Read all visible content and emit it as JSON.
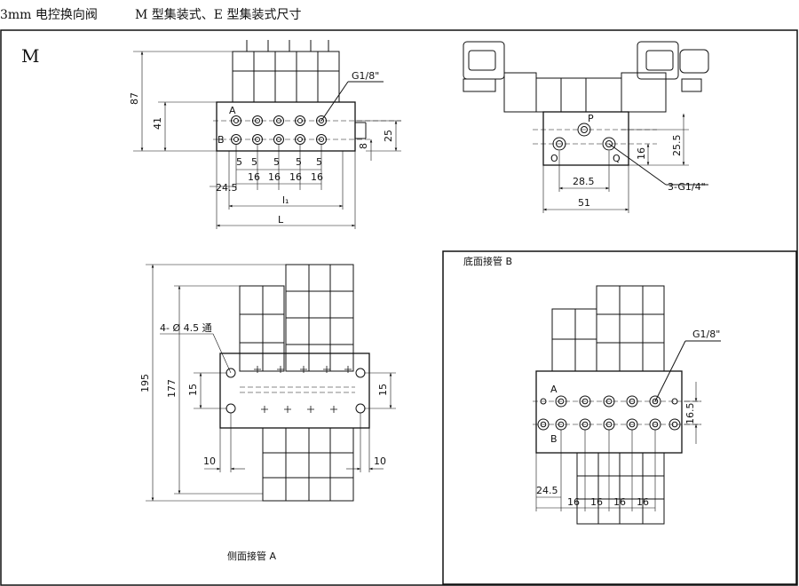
{
  "header": {
    "model": "3mm 电控换向阀",
    "subtitle": "M 型集装式、E 型集装式尺寸"
  },
  "panel": {
    "label": "M"
  },
  "front_view": {
    "dims": {
      "h87": "87",
      "h41": "41",
      "h25": "25",
      "h8": "8",
      "p5a": "5",
      "p5b": "5",
      "p5c": "5",
      "p5d": "5",
      "p5e": "5",
      "p16a": "16",
      "p16b": "16",
      "p16c": "16",
      "p16d": "16",
      "w245": "24.5",
      "l1": "l₁",
      "L": "L"
    },
    "port_label": "G1/8\"",
    "row_a": "A",
    "row_b": "B"
  },
  "end_view": {
    "dims": {
      "d285": "28.5",
      "d51": "51",
      "d255": "25.5",
      "d16": "16"
    },
    "port_p": "P",
    "port_o": "O",
    "port_q": "Q",
    "port_label": "3-G1/4\""
  },
  "side_view": {
    "dims": {
      "h195": "195",
      "h177": "177",
      "h15a": "15",
      "h15b": "15",
      "w10a": "10",
      "w10b": "10"
    },
    "hole_label": "4- Ø 4.5 通",
    "caption": "侧面接管 A"
  },
  "bottom_view": {
    "title": "底面接管 B",
    "port_label": "G1/8\"",
    "row_a": "A",
    "row_b": "B",
    "dims": {
      "h165": "16.5",
      "w245": "24.5",
      "p16a": "16",
      "p16b": "16",
      "p16c": "16",
      "p16d": "16"
    }
  }
}
